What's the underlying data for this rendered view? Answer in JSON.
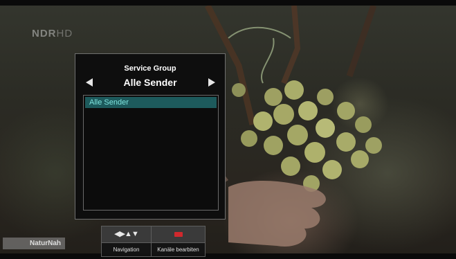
{
  "channel": {
    "logo_main": "NDR",
    "logo_hd": "HD"
  },
  "program": {
    "label": "NaturNah"
  },
  "dialog": {
    "title": "Service Group",
    "selected_group": "Alle Sender",
    "list_items": [
      "Alle Sender"
    ]
  },
  "help_bar": {
    "navigation_symbols": "◀▶▲▼",
    "navigation_label": "Navigation",
    "edit_label": "Kanäle bearbiten"
  },
  "colors": {
    "selection_bg": "#1d5a5c",
    "selection_text": "#7fe6e0",
    "red_key": "#d0282d"
  }
}
